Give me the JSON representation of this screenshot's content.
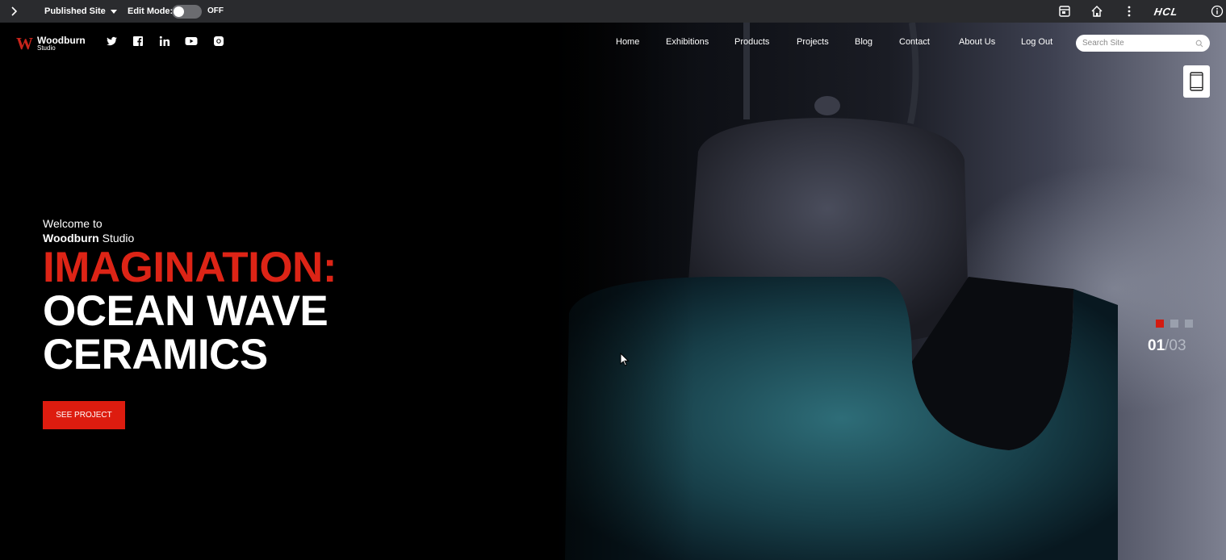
{
  "toolbar": {
    "site_selector": "Published Site",
    "edit_mode_label": "Edit Mode:",
    "edit_mode_state": "OFF",
    "brand_logo": "HCL",
    "icons": [
      "chevron-right-icon",
      "app-icon",
      "home-icon",
      "more-vertical-icon",
      "info-icon"
    ]
  },
  "site": {
    "brand_mark": "W",
    "brand_name": "Woodburn",
    "brand_sub": "Studio",
    "social": [
      "twitter-icon",
      "facebook-icon",
      "linkedin-icon",
      "youtube-icon",
      "instagram-icon"
    ],
    "nav": [
      "Home",
      "Exhibitions",
      "Products",
      "Projects",
      "Blog",
      "Contact",
      "About Us",
      "Log Out"
    ],
    "search_placeholder": "Search Site"
  },
  "hero": {
    "welcome": "Welcome to",
    "welcome_brand": "Woodburn",
    "welcome_brand_rest": " Studio",
    "headline_accent": "IMAGINATION:",
    "headline_line2": "OCEAN WAVE",
    "headline_line3": "CERAMICS",
    "cta": "SEE PROJECT",
    "slide_current": "01",
    "slide_total": "/03",
    "slides_count": 3,
    "slide_active_index": 0
  },
  "colors": {
    "accent": "#dd2416",
    "toolbar_bg": "#2a2b2e"
  }
}
